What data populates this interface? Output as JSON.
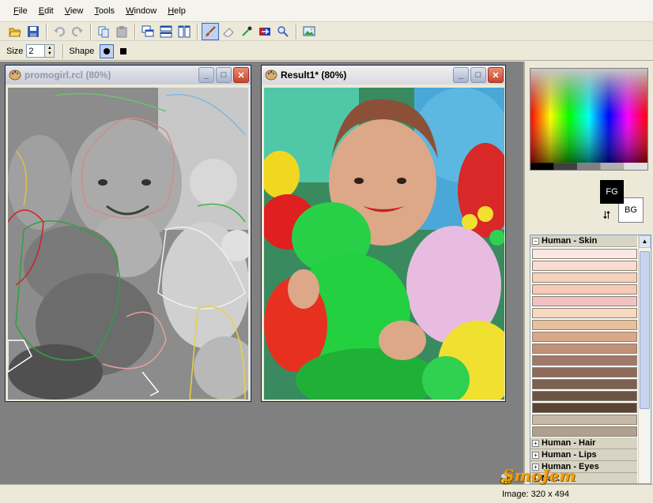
{
  "menu": [
    {
      "first": "F",
      "rest": "ile"
    },
    {
      "first": "E",
      "rest": "dit"
    },
    {
      "first": "V",
      "rest": "iew"
    },
    {
      "first": "T",
      "rest": "ools"
    },
    {
      "first": "W",
      "rest": "indow"
    },
    {
      "first": "H",
      "rest": "elp"
    }
  ],
  "options": {
    "size_label": "Size",
    "size_value": "2",
    "shape_label": "Shape"
  },
  "windows": {
    "source": {
      "title": "promogirl.rcl (80%)"
    },
    "result": {
      "title": "Result1* (80%)"
    }
  },
  "colors": {
    "fg_label": "FG",
    "bg_label": "BG",
    "fg": "#000000",
    "bg": "#ffffff"
  },
  "swatch_groups": {
    "skin": {
      "label": "Human - Skin",
      "colors": [
        "#fbe8e4",
        "#f9dcd2",
        "#f6d2bc",
        "#f5cab8",
        "#f2c2c2",
        "#f7d9c0",
        "#e8c09c",
        "#d8a888",
        "#c09078",
        "#a07868",
        "#8c6a5c",
        "#7c6050",
        "#6c5444",
        "#5c4434",
        "#c8b8a8",
        "#b0a090"
      ]
    },
    "collapsed": [
      {
        "label": "Human - Hair"
      },
      {
        "label": "Human - Lips"
      },
      {
        "label": "Human - Eyes"
      },
      {
        "label": "Na..."
      }
    ]
  },
  "status": {
    "image_info": "Image: 320 x 494"
  },
  "watermark": "SmoJem"
}
